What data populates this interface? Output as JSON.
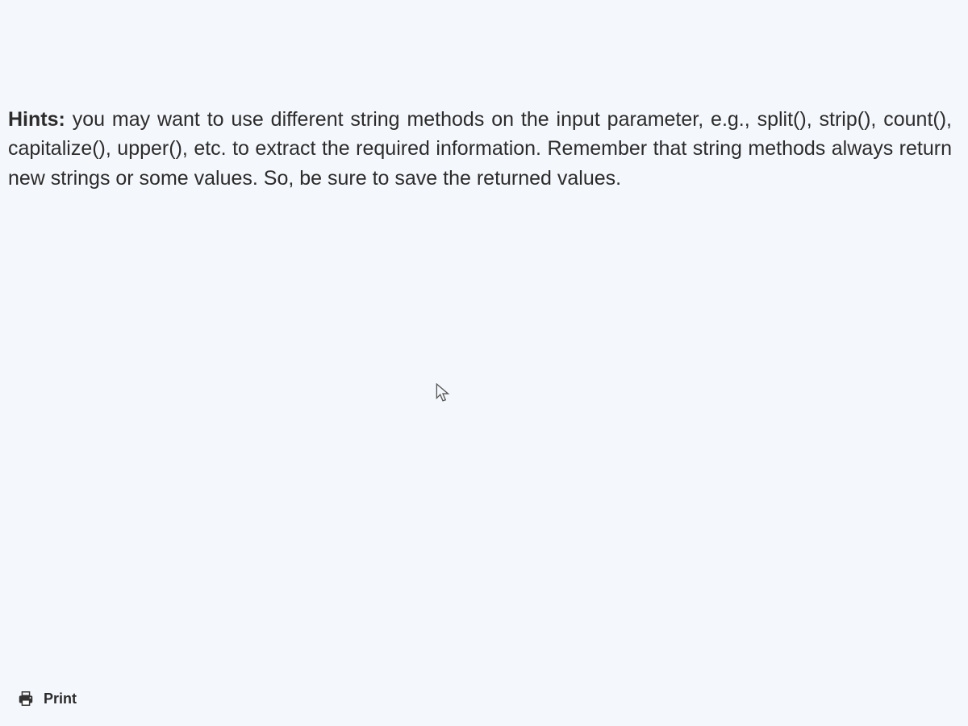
{
  "content": {
    "hints_label": "Hints:",
    "hints_body": " you may want to use different string methods on the input parameter, e.g., split(), strip(), count(), capitalize(), upper(), etc. to extract the required information. Remember that string methods always return new strings or some values. So, be sure to save the returned values."
  },
  "footer": {
    "print_label": "Print"
  }
}
